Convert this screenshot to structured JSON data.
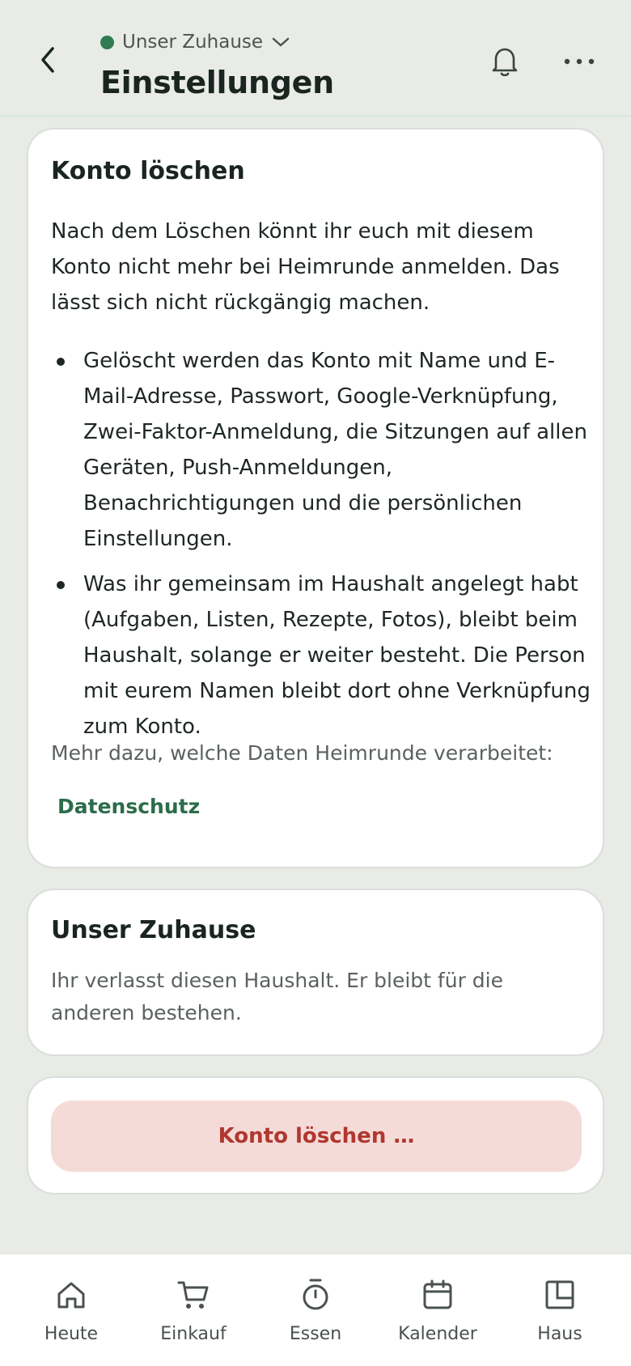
{
  "header": {
    "household_name": "Unser Zuhause",
    "title": "Einstellungen",
    "icons": [
      "chevron-left-icon",
      "chevron-down-icon",
      "bell-icon",
      "more-horizontal-icon"
    ],
    "status_color": "#2f7b52"
  },
  "delete_card": {
    "title": "Konto löschen",
    "intro": "Nach dem Löschen könnt ihr euch mit diesem Konto nicht mehr bei Heimrunde anmelden. Das lässt sich nicht rückgängig machen.",
    "bullets": [
      "Gelöscht werden das Konto mit Name und E-Mail-Adresse, Passwort, Google-Verknüpfung, Zwei-Faktor-Anmeldung, die Sitzungen auf allen Geräten, Push-Anmeldungen, Benachrichtigungen und die persönlichen Einstellungen.",
      "Was ihr gemeinsam im Haushalt angelegt habt (Aufgaben, Listen, Rezepte, Fotos), bleibt beim Haushalt, solange er weiter besteht. Die Person mit eurem Namen bleibt dort ohne Verknüpfung zum Konto."
    ],
    "more_info": "Mehr dazu, welche Daten Heimrunde verarbeitet:",
    "privacy_link": "Datenschutz"
  },
  "household_card": {
    "title": "Unser Zuhause",
    "description": "Ihr verlasst diesen Haushalt. Er bleibt für die anderen bestehen."
  },
  "action": {
    "delete_button": "Konto löschen …",
    "danger_color": "#b0372f"
  },
  "nav": {
    "items": [
      {
        "label": "Heute",
        "icon": "home-icon"
      },
      {
        "label": "Einkauf",
        "icon": "cart-icon"
      },
      {
        "label": "Essen",
        "icon": "timer-icon"
      },
      {
        "label": "Kalender",
        "icon": "calendar-icon"
      },
      {
        "label": "Haus",
        "icon": "layout-icon"
      }
    ]
  }
}
